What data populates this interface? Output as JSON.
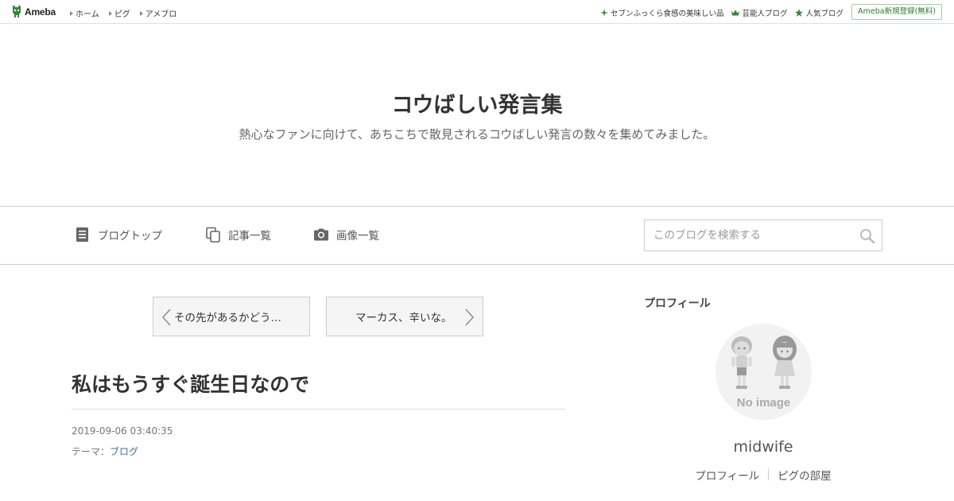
{
  "topbar": {
    "logo_text": "Ameba",
    "nav": [
      {
        "label": "ホーム"
      },
      {
        "label": "ピグ"
      },
      {
        "label": "アメブロ"
      }
    ],
    "right_links": [
      {
        "label": "セブンふっくら食感の美味しい品",
        "icon": "sparkle-icon"
      },
      {
        "label": "芸能人ブログ",
        "icon": "crown-icon"
      },
      {
        "label": "人気ブログ",
        "icon": "star-icon"
      }
    ],
    "signup_label": "Ameba新規登録(無料)"
  },
  "header": {
    "title": "コウばしい発言集",
    "description": "熱心なファンに向けて、あちこちで散見されるコウばしい発言の数々を集めてみました。"
  },
  "blognav": {
    "items": [
      {
        "label": "ブログトップ",
        "icon": "document-icon"
      },
      {
        "label": "記事一覧",
        "icon": "copy-icon"
      },
      {
        "label": "画像一覧",
        "icon": "camera-icon"
      }
    ],
    "search_placeholder": "このブログを検索する"
  },
  "pager": {
    "prev_label": "その先があるかどう…",
    "next_label": "マーカス、辛いな。"
  },
  "article": {
    "title": "私はもうすぐ誕生日なので",
    "date": "2019-09-06 03:40:35",
    "theme_prefix": "テーマ：",
    "theme_link": "ブログ"
  },
  "sidebar": {
    "heading": "プロフィール",
    "avatar_caption": "No image",
    "name": "midwife",
    "links": [
      "プロフィール",
      "ピグの部屋"
    ]
  },
  "colors": {
    "accent_green": "#2d7d2d",
    "link_blue": "#3a6ea5"
  }
}
